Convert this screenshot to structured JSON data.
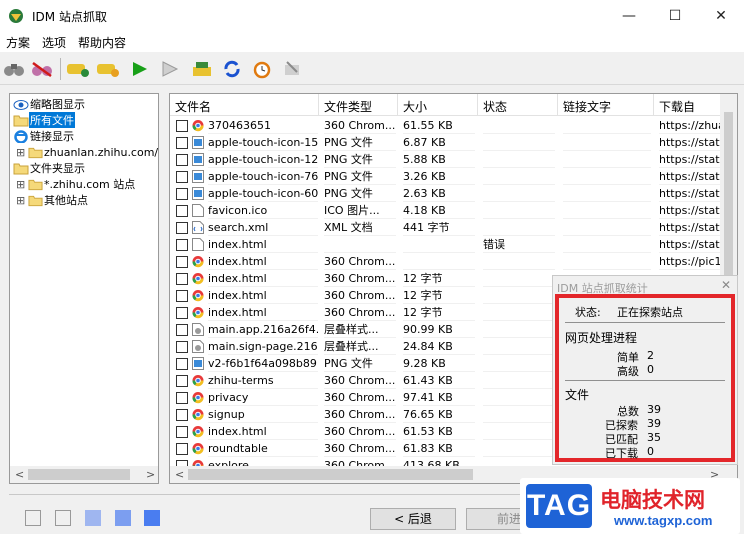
{
  "window": {
    "title": "IDM 站点抓取",
    "minimize": "—",
    "maximize": "☐",
    "close": "✕"
  },
  "menu": [
    "方案",
    "选项",
    "帮助内容"
  ],
  "toolbar": [
    "binoculars",
    "forbid-binoculars",
    "site-grab",
    "site-grab-2",
    "start",
    "stop",
    "download",
    "refresh",
    "schedule",
    "tools"
  ],
  "tree": [
    {
      "label": "缩略图显示",
      "icon": "eye-icon",
      "indent": 0,
      "selected": false,
      "expander": ""
    },
    {
      "label": "所有文件",
      "icon": "folder-open-icon",
      "indent": 0,
      "selected": true,
      "expander": ""
    },
    {
      "label": "链接显示",
      "icon": "ie-icon",
      "indent": 0,
      "selected": false,
      "expander": ""
    },
    {
      "label": "zhuanlan.zhihu.com/p",
      "icon": "folder-icon",
      "indent": 1,
      "selected": false,
      "expander": "⊞"
    },
    {
      "label": "文件夹显示",
      "icon": "folder-icon",
      "indent": 0,
      "selected": false,
      "expander": ""
    },
    {
      "label": "*.zhihu.com 站点",
      "icon": "folder-icon",
      "indent": 1,
      "selected": false,
      "expander": "⊞"
    },
    {
      "label": "其他站点",
      "icon": "folder-icon",
      "indent": 1,
      "selected": false,
      "expander": "⊞"
    }
  ],
  "tree_scroll": {
    "left": "<",
    "right": ">"
  },
  "list": {
    "headers": [
      "文件名",
      "文件类型",
      "大小",
      "状态",
      "链接文字",
      "下载自"
    ],
    "rows": [
      {
        "name": "370463651",
        "type": "360 Chrom...",
        "size": "61.55 KB",
        "status": "",
        "from": "https://zhuan",
        "icon": "chrome"
      },
      {
        "name": "apple-touch-icon-15...",
        "type": "PNG 文件",
        "size": "6.87 KB",
        "status": "",
        "from": "https://static",
        "icon": "png"
      },
      {
        "name": "apple-touch-icon-12...",
        "type": "PNG 文件",
        "size": "5.88 KB",
        "status": "",
        "from": "https://static",
        "icon": "png"
      },
      {
        "name": "apple-touch-icon-76...",
        "type": "PNG 文件",
        "size": "3.26 KB",
        "status": "",
        "from": "https://static",
        "icon": "png"
      },
      {
        "name": "apple-touch-icon-60...",
        "type": "PNG 文件",
        "size": "2.63 KB",
        "status": "",
        "from": "https://static",
        "icon": "png"
      },
      {
        "name": "favicon.ico",
        "type": "ICO 图片...",
        "size": "4.18 KB",
        "status": "",
        "from": "https://static",
        "icon": "blank"
      },
      {
        "name": "search.xml",
        "type": "XML 文档",
        "size": "441 字节",
        "status": "",
        "from": "https://static",
        "icon": "xml"
      },
      {
        "name": "index.html",
        "type": "",
        "size": "",
        "status": "错误",
        "from": "https://static",
        "icon": "blank"
      },
      {
        "name": "index.html",
        "type": "360 Chrom...",
        "size": "",
        "status": "",
        "from": "https://pic1.z",
        "icon": "chrome"
      },
      {
        "name": "index.html",
        "type": "360 Chrom...",
        "size": "12 字节",
        "status": "",
        "from": "",
        "icon": "chrome"
      },
      {
        "name": "index.html",
        "type": "360 Chrom...",
        "size": "12 字节",
        "status": "",
        "from": "",
        "icon": "chrome"
      },
      {
        "name": "index.html",
        "type": "360 Chrom...",
        "size": "12 字节",
        "status": "",
        "from": "",
        "icon": "chrome"
      },
      {
        "name": "main.app.216a26f4....",
        "type": "层叠样式...",
        "size": "90.99 KB",
        "status": "",
        "from": "",
        "icon": "css"
      },
      {
        "name": "main.sign-page.216...",
        "type": "层叠样式...",
        "size": "24.84 KB",
        "status": "",
        "from": "",
        "icon": "css"
      },
      {
        "name": "v2-f6b1f64a098b89...",
        "type": "PNG 文件",
        "size": "9.28 KB",
        "status": "",
        "from": "",
        "icon": "png"
      },
      {
        "name": "zhihu-terms",
        "type": "360 Chrom...",
        "size": "61.43 KB",
        "status": "",
        "from": "",
        "icon": "chrome"
      },
      {
        "name": "privacy",
        "type": "360 Chrom...",
        "size": "97.41 KB",
        "status": "",
        "from": "",
        "icon": "chrome"
      },
      {
        "name": "signup",
        "type": "360 Chrom...",
        "size": "76.65 KB",
        "status": "",
        "from": "",
        "icon": "chrome"
      },
      {
        "name": "index.html",
        "type": "360 Chrom...",
        "size": "61.53 KB",
        "status": "",
        "from": "",
        "icon": "chrome"
      },
      {
        "name": "roundtable",
        "type": "360 Chrom...",
        "size": "61.83 KB",
        "status": "",
        "from": "",
        "icon": "chrome"
      },
      {
        "name": "explore",
        "type": "360 Chrom...",
        "size": "413.68 KB",
        "status": "",
        "from": "",
        "icon": "chrome"
      }
    ],
    "scroll": {
      "left": "<",
      "right": ">"
    }
  },
  "stats": {
    "title": "IDM 站点抓取统计",
    "close": "✕",
    "state_label": "状态:",
    "state_value": "正在探索站点",
    "progress_title": "网页处理进程",
    "simple_label": "简单",
    "simple_value": "2",
    "advanced_label": "高级",
    "advanced_value": "0",
    "files_title": "文件",
    "total_label": "总数",
    "total_value": "39",
    "explored_label": "已探索",
    "explored_value": "39",
    "matched_label": "已匹配",
    "matched_value": "35",
    "downloaded_label": "已下载",
    "downloaded_value": "0"
  },
  "footer": {
    "squares": [
      "#f0f0f0",
      "#f0f0f0",
      "#9fb6f0",
      "#7c9ef0",
      "#4a7df0"
    ],
    "back": "< 后退",
    "next": "前进"
  },
  "watermark": {
    "tag": "TAG",
    "site": "电脑技术网",
    "url": "www.tagxp.com"
  }
}
